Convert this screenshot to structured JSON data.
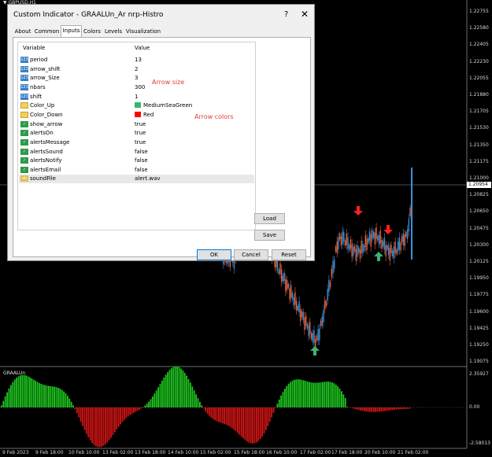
{
  "chart": {
    "symbol_label": "GBPUSD,H1",
    "indicator_label": "GRAALUn",
    "current_price": "1.20954",
    "price_axis": [
      "1.22755",
      "1.22580",
      "1.22405",
      "1.22230",
      "1.22055",
      "1.21880",
      "1.21705",
      "1.21530",
      "1.21350",
      "1.21175",
      "1.21000",
      "1.20825",
      "1.20650",
      "1.20475",
      "1.20300",
      "1.20125",
      "1.19950",
      "1.19775",
      "1.19600",
      "1.19425",
      "1.19250",
      "1.19075"
    ],
    "indicator_axis": [
      "2.35927",
      "0.00",
      "-2.58013"
    ],
    "time_axis": [
      "9 Feb 2023",
      "9 Feb 18:00",
      "10 Feb 10:00",
      "13 Feb 02:00",
      "13 Feb 18:00",
      "14 Feb 10:00",
      "15 Feb 02:00",
      "15 Feb 18:00",
      "16 Feb 10:00",
      "17 Feb 02:00",
      "17 Feb 18:00",
      "20 Feb 10:00",
      "21 Feb 02:00"
    ],
    "colors": {
      "bull": "#3d8fd9",
      "bear": "#e8643c",
      "hist_up": "#1ec81e",
      "hist_down": "#d21414",
      "arrow_up": "#3cb371",
      "arrow_down": "#ff2020"
    }
  },
  "dialog": {
    "title": "Custom Indicator - GRAALUn_Ar nrp-Histro",
    "help": "?",
    "close": "✕",
    "tabs": [
      "About",
      "Common",
      "Inputs",
      "Colors",
      "Levels",
      "Visualization"
    ],
    "active_tab": "Inputs",
    "columns": {
      "variable": "Variable",
      "value": "Value"
    },
    "rows": [
      {
        "icon": "int-icon",
        "name": "period",
        "value": "13"
      },
      {
        "icon": "int-icon",
        "name": "arrow_shift",
        "value": "2"
      },
      {
        "icon": "int-icon",
        "name": "arrow_Size",
        "value": "3"
      },
      {
        "icon": "int-icon",
        "name": "nbars",
        "value": "300"
      },
      {
        "icon": "int-icon",
        "name": "shift",
        "value": "1"
      },
      {
        "icon": "color-icon",
        "name": "Color_Up",
        "value": "MediumSeaGreen",
        "swatch": "#3cb371"
      },
      {
        "icon": "color-icon",
        "name": "Color_Down",
        "value": "Red",
        "swatch": "#ff0000"
      },
      {
        "icon": "bool-icon",
        "name": "show_arrow",
        "value": "true"
      },
      {
        "icon": "bool-icon",
        "name": "alertsOn",
        "value": "true"
      },
      {
        "icon": "bool-icon",
        "name": "alertsMessage",
        "value": "true"
      },
      {
        "icon": "bool-icon",
        "name": "alertsSound",
        "value": "false"
      },
      {
        "icon": "bool-icon",
        "name": "alertsNotify",
        "value": "false"
      },
      {
        "icon": "bool-icon",
        "name": "alertsEmail",
        "value": "false"
      },
      {
        "icon": "string-icon",
        "name": "soundFile",
        "value": "alert.wav"
      }
    ],
    "notes": {
      "arrow_size": "Arrow size",
      "arrow_colors": "Arrow colors"
    },
    "buttons": {
      "load": "Load",
      "save": "Save",
      "ok": "OK",
      "cancel": "Cancel",
      "reset": "Reset"
    }
  }
}
